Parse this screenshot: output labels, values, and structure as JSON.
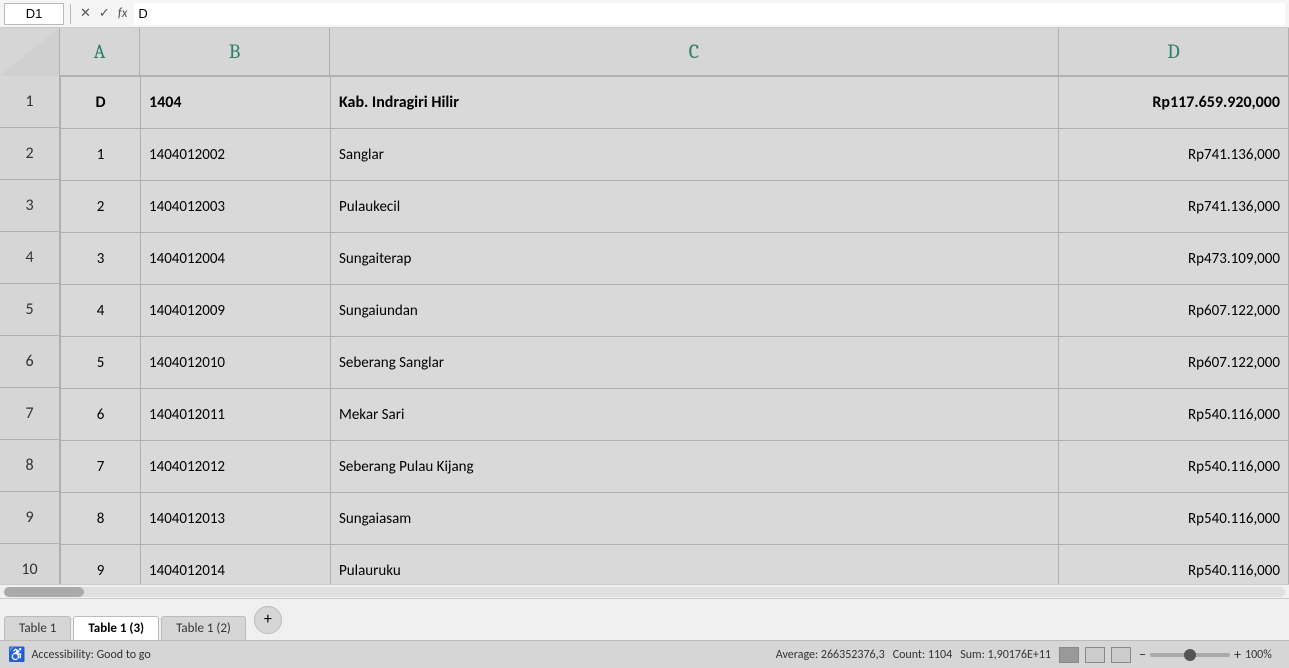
{
  "formulaBar": {
    "cellRef": "D1",
    "cancelIcon": "✕",
    "confirmIcon": "✓",
    "fxLabel": "fx",
    "value": "D"
  },
  "columns": {
    "corner": "",
    "a": "A",
    "b": "B",
    "c": "C",
    "d": "D"
  },
  "rows": [
    {
      "rowNum": "1",
      "a": "D",
      "b": "1404",
      "c": "Kab. Indragiri Hilir",
      "d": "Rp117.659.920,000"
    },
    {
      "rowNum": "2",
      "a": "1",
      "b": "1404012002",
      "c": "Sanglar",
      "d": "Rp741.136,000"
    },
    {
      "rowNum": "3",
      "a": "2",
      "b": "1404012003",
      "c": "Pulaukecil",
      "d": "Rp741.136,000"
    },
    {
      "rowNum": "4",
      "a": "3",
      "b": "1404012004",
      "c": "Sungaiterap",
      "d": "Rp473.109,000"
    },
    {
      "rowNum": "5",
      "a": "4",
      "b": "1404012009",
      "c": "Sungaiundan",
      "d": "Rp607.122,000"
    },
    {
      "rowNum": "6",
      "a": "5",
      "b": "1404012010",
      "c": "Seberang Sanglar",
      "d": "Rp607.122,000"
    },
    {
      "rowNum": "7",
      "a": "6",
      "b": "1404012011",
      "c": "Mekar Sari",
      "d": "Rp540.116,000"
    },
    {
      "rowNum": "8",
      "a": "7",
      "b": "1404012012",
      "c": "Seberang Pulau Kijang",
      "d": "Rp540.116,000"
    },
    {
      "rowNum": "9",
      "a": "8",
      "b": "1404012013",
      "c": "Sungaiasam",
      "d": "Rp540.116,000"
    },
    {
      "rowNum": "10",
      "a": "9",
      "b": "1404012014",
      "c": "Pulauruku",
      "d": "Rp540.116,000"
    }
  ],
  "tabs": [
    {
      "label": "Table 1",
      "active": false
    },
    {
      "label": "Table 1 (3)",
      "active": true
    },
    {
      "label": "Table 1 (2)",
      "active": false
    }
  ],
  "addTabLabel": "+",
  "statusBar": {
    "accessibilityText": "Accessibility: Good to go",
    "averageLabel": "Average: 266352376,3",
    "countLabel": "Count: 1104",
    "sumLabel": "Sum: 1,90176E+11",
    "zoomLevel": "100%"
  }
}
